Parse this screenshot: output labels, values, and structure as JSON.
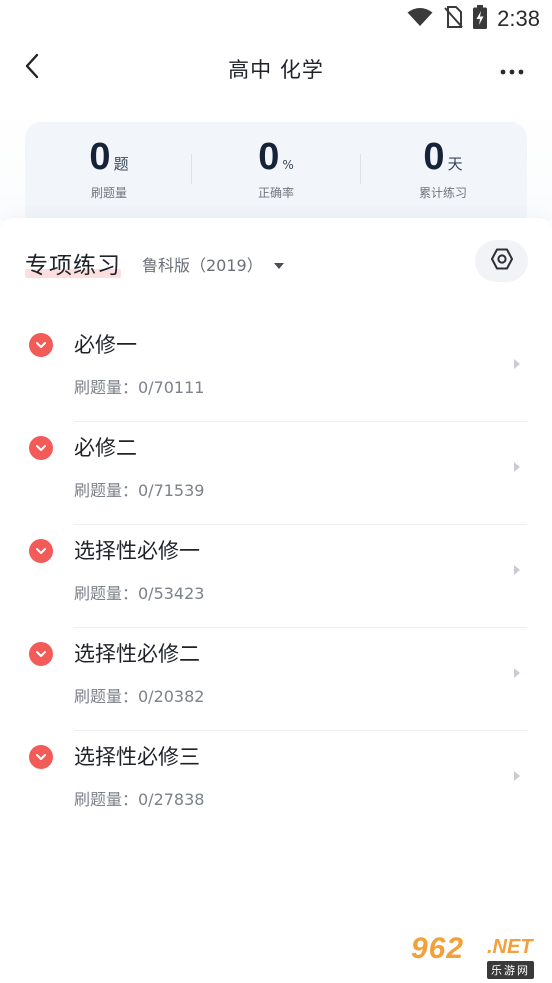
{
  "status_bar": {
    "time": "2:38",
    "icons": [
      "wifi-icon",
      "no-sim-icon",
      "battery-charging-icon"
    ]
  },
  "nav": {
    "title": "高中 化学",
    "back_icon": "chevron-left-icon",
    "more_icon": "more-horizontal-icon"
  },
  "stats": [
    {
      "value": "0",
      "unit": "题",
      "label": "刷题量"
    },
    {
      "value": "0",
      "unit": "%",
      "label": "正确率"
    },
    {
      "value": "0",
      "unit": "天",
      "label": "累计练习"
    }
  ],
  "section": {
    "title": "专项练习",
    "edition": "鲁科版（2019）",
    "settings_icon": "hexagon-settings-icon",
    "underline_color": "#fbdedd"
  },
  "items": [
    {
      "title": "必修一",
      "progress": "刷题量：0/70111"
    },
    {
      "title": "必修二",
      "progress": "刷题量：0/71539"
    },
    {
      "title": "选择性必修一",
      "progress": "刷题量：0/53423"
    },
    {
      "title": "选择性必修二",
      "progress": "刷题量：0/20382"
    },
    {
      "title": "选择性必修三",
      "progress": "刷题量：0/27838"
    }
  ],
  "colors": {
    "accent": "#f25b58",
    "stat_value": "#152238",
    "card_bg": "#f2f6fb"
  },
  "watermark": {
    "number": "962",
    "suffix": ".NET",
    "sub": "乐游网"
  }
}
